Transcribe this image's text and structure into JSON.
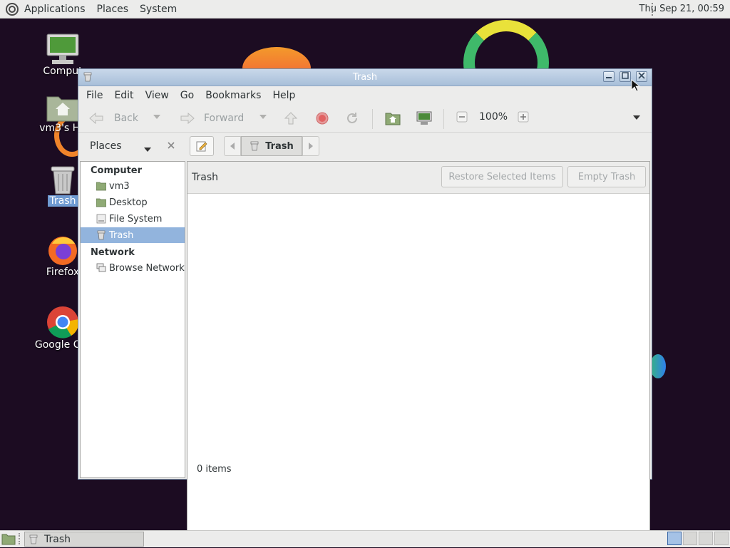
{
  "top_panel": {
    "menus": [
      "Applications",
      "Places",
      "System"
    ],
    "clock": "Thu Sep 21, 00:59"
  },
  "desktop": {
    "icons": [
      {
        "label": "Comput",
        "icon": "computer-icon"
      },
      {
        "label": "vm3's Ho",
        "icon": "home-folder-icon"
      },
      {
        "label": "Trash",
        "icon": "trash-icon"
      },
      {
        "label": "Firefox",
        "icon": "firefox-icon"
      },
      {
        "label": "Google Chr",
        "icon": "chrome-icon"
      }
    ]
  },
  "window": {
    "title": "Trash",
    "menu": [
      "File",
      "Edit",
      "View",
      "Go",
      "Bookmarks",
      "Help"
    ],
    "toolbar": {
      "back_label": "Back",
      "forward_label": "Forward",
      "zoom": "100%"
    },
    "sidebar": {
      "title": "Places",
      "sections": [
        {
          "heading": "Computer",
          "items": [
            "vm3",
            "Desktop",
            "File System",
            "Trash"
          ]
        },
        {
          "heading": "Network",
          "items": [
            "Browse Network"
          ]
        }
      ],
      "selected": "Trash"
    },
    "path": {
      "current": "Trash"
    },
    "trash_bar": {
      "label": "Trash",
      "restore_label": "Restore Selected Items",
      "empty_label": "Empty Trash"
    },
    "status": "0 items"
  },
  "bottom_panel": {
    "task_label": "Trash"
  },
  "colors": {
    "desktop_bg": "#1c0c22",
    "selection": "#92b4dd",
    "titlebar": "#b4c8df"
  }
}
